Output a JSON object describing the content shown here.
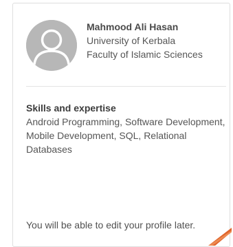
{
  "profile": {
    "name": "Mahmood Ali Hasan",
    "institution": "University of Kerbala",
    "department": "Faculty of Islamic Sciences",
    "avatar_icon": "default-user-icon"
  },
  "skills": {
    "title": "Skills and expertise",
    "text": "Android Programming, Software Development, Mobile Development, SQL, Relational Databases"
  },
  "note": "You will be able to edit your profile later.",
  "colors": {
    "accent_corner": "#e0652c",
    "avatar_bg": "#b7b7b7",
    "border": "#dedede"
  }
}
